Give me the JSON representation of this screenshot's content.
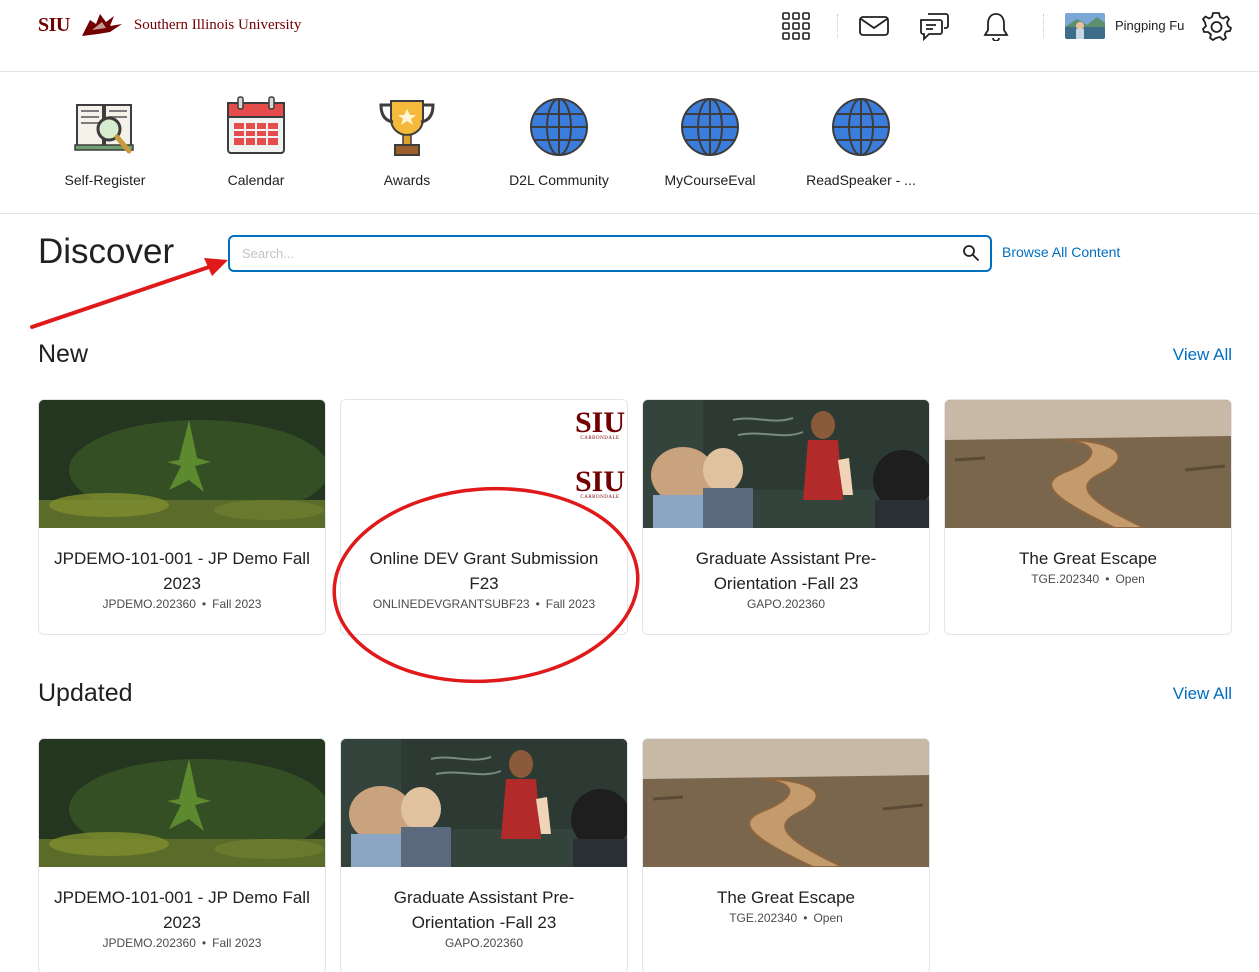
{
  "header": {
    "logo_short": "SIU",
    "university_name": "Southern Illinois University",
    "username": "Pingping Fu",
    "icons": [
      "apps-grid-icon",
      "mail-icon",
      "chat-icon",
      "bell-icon",
      "gear-icon"
    ]
  },
  "nav": {
    "items": [
      {
        "label": "Self-Register",
        "icon": "book-magnifier-icon"
      },
      {
        "label": "Calendar",
        "icon": "calendar-icon"
      },
      {
        "label": "Awards",
        "icon": "trophy-icon"
      },
      {
        "label": "D2L Community",
        "icon": "globe-icon"
      },
      {
        "label": "MyCourseEval",
        "icon": "globe-icon"
      },
      {
        "label": "ReadSpeaker - ...",
        "icon": "globe-icon"
      }
    ]
  },
  "discover": {
    "title": "Discover",
    "search_placeholder": "Search...",
    "browse_all": "Browse All Content"
  },
  "new_section": {
    "title": "New",
    "view_all": "View All",
    "cards": [
      {
        "title": "JPDEMO-101-001 - JP Demo Fall 2023",
        "code": "JPDEMO.202360",
        "term": "Fall 2023",
        "image": "forest"
      },
      {
        "title": "Online DEV Grant Submission F23",
        "code": "ONLINEDEVGRANTSUBF23",
        "term": "Fall 2023",
        "image": "siu-logo"
      },
      {
        "title": "Graduate Assistant Pre-Orientation -Fall 23",
        "code": "GAPO.202360",
        "term": "",
        "image": "classroom"
      },
      {
        "title": "The Great Escape",
        "code": "TGE.202340",
        "term": "Open",
        "image": "wooden-path"
      }
    ]
  },
  "updated_section": {
    "title": "Updated",
    "view_all": "View All",
    "cards": [
      {
        "title": "JPDEMO-101-001 - JP Demo Fall 2023",
        "code": "JPDEMO.202360",
        "term": "Fall 2023",
        "image": "forest"
      },
      {
        "title": "Graduate Assistant Pre-Orientation -Fall 23",
        "code": "GAPO.202360",
        "term": "",
        "image": "classroom"
      },
      {
        "title": "The Great Escape",
        "code": "TGE.202340",
        "term": "Open",
        "image": "wooden-path"
      }
    ]
  },
  "colors": {
    "link": "#006fbf",
    "brand": "#720000",
    "annotation": "#e0191b"
  }
}
